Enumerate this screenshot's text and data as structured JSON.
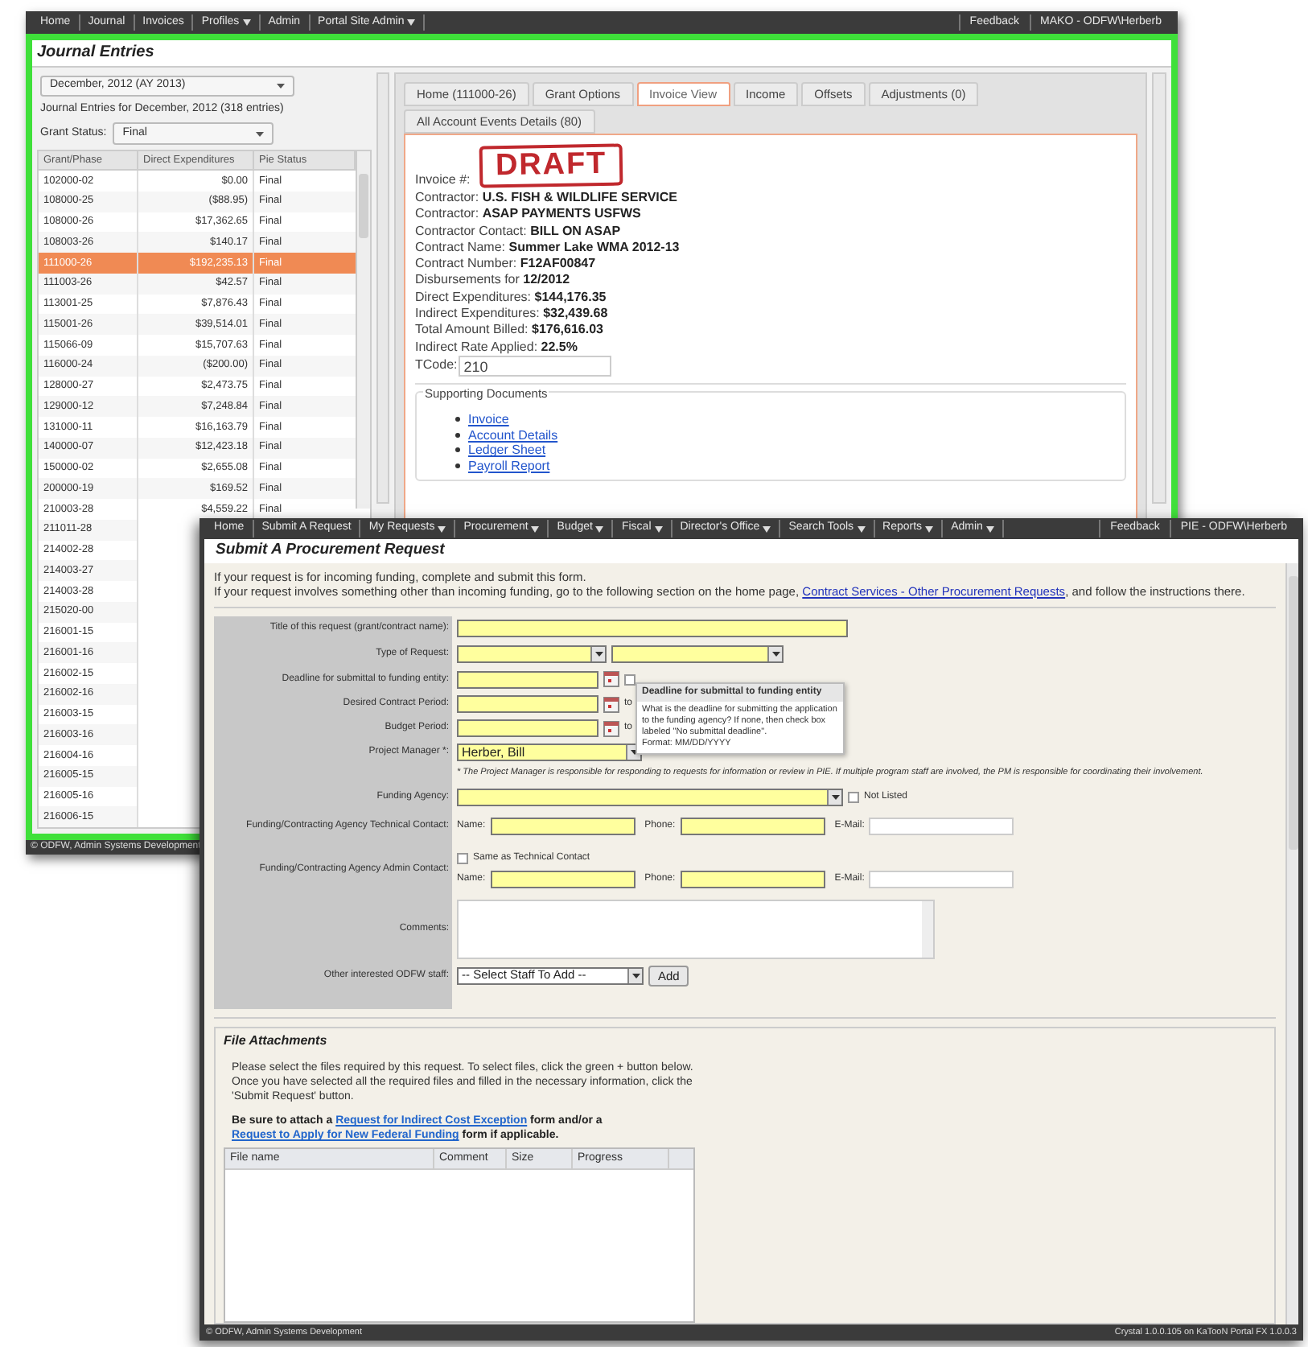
{
  "journal_window": {
    "nav": {
      "items": [
        {
          "label": "Home",
          "menu": false
        },
        {
          "label": "Journal",
          "menu": false
        },
        {
          "label": "Invoices",
          "menu": false
        },
        {
          "label": "Profiles",
          "menu": true
        },
        {
          "label": "Admin",
          "menu": false
        },
        {
          "label": "Portal Site Admin",
          "menu": true
        }
      ],
      "feedback": "Feedback",
      "user": "MAKO - ODFW\\Herberb"
    },
    "title": "Journal Entries",
    "period_select": "December, 2012 (AY 2013)",
    "summary": "Journal Entries for December, 2012 (318 entries)",
    "grant_status": {
      "label": "Grant Status:",
      "value": "Final"
    },
    "table": {
      "columns": [
        "Grant/Phase",
        "Direct Expenditures",
        "Pie Status"
      ],
      "rows": [
        {
          "grant_phase": "102000-02",
          "direct_expenditures": "$0.00",
          "pie_status": "Final",
          "selected": false
        },
        {
          "grant_phase": "108000-25",
          "direct_expenditures": "($88.95)",
          "pie_status": "Final",
          "selected": false
        },
        {
          "grant_phase": "108000-26",
          "direct_expenditures": "$17,362.65",
          "pie_status": "Final",
          "selected": false
        },
        {
          "grant_phase": "108003-26",
          "direct_expenditures": "$140.17",
          "pie_status": "Final",
          "selected": false
        },
        {
          "grant_phase": "111000-26",
          "direct_expenditures": "$192,235.13",
          "pie_status": "Final",
          "selected": true
        },
        {
          "grant_phase": "111003-26",
          "direct_expenditures": "$42.57",
          "pie_status": "Final",
          "selected": false
        },
        {
          "grant_phase": "113001-25",
          "direct_expenditures": "$7,876.43",
          "pie_status": "Final",
          "selected": false
        },
        {
          "grant_phase": "115001-26",
          "direct_expenditures": "$39,514.01",
          "pie_status": "Final",
          "selected": false
        },
        {
          "grant_phase": "115066-09",
          "direct_expenditures": "$15,707.63",
          "pie_status": "Final",
          "selected": false
        },
        {
          "grant_phase": "116000-24",
          "direct_expenditures": "($200.00)",
          "pie_status": "Final",
          "selected": false
        },
        {
          "grant_phase": "128000-27",
          "direct_expenditures": "$2,473.75",
          "pie_status": "Final",
          "selected": false
        },
        {
          "grant_phase": "129000-12",
          "direct_expenditures": "$7,248.84",
          "pie_status": "Final",
          "selected": false
        },
        {
          "grant_phase": "131000-11",
          "direct_expenditures": "$16,163.79",
          "pie_status": "Final",
          "selected": false
        },
        {
          "grant_phase": "140000-07",
          "direct_expenditures": "$12,423.18",
          "pie_status": "Final",
          "selected": false
        },
        {
          "grant_phase": "150000-02",
          "direct_expenditures": "$2,655.08",
          "pie_status": "Final",
          "selected": false
        },
        {
          "grant_phase": "200000-19",
          "direct_expenditures": "$169.52",
          "pie_status": "Final",
          "selected": false
        },
        {
          "grant_phase": "210003-28",
          "direct_expenditures": "$4,559.22",
          "pie_status": "Final",
          "selected": false
        },
        {
          "grant_phase": "211011-28",
          "selected": false
        },
        {
          "grant_phase": "214002-28",
          "selected": false
        },
        {
          "grant_phase": "214003-27",
          "selected": false
        },
        {
          "grant_phase": "214003-28",
          "selected": false
        },
        {
          "grant_phase": "215020-00",
          "selected": false
        },
        {
          "grant_phase": "216001-15",
          "selected": false
        },
        {
          "grant_phase": "216001-16",
          "selected": false
        },
        {
          "grant_phase": "216002-15",
          "selected": false
        },
        {
          "grant_phase": "216002-16",
          "selected": false
        },
        {
          "grant_phase": "216003-15",
          "selected": false
        },
        {
          "grant_phase": "216003-16",
          "selected": false
        },
        {
          "grant_phase": "216004-16",
          "selected": false
        },
        {
          "grant_phase": "216005-15",
          "selected": false
        },
        {
          "grant_phase": "216005-16",
          "selected": false
        },
        {
          "grant_phase": "216006-15",
          "selected": false
        }
      ]
    },
    "tabs": [
      {
        "label": "Home (111000-26)",
        "selected": false
      },
      {
        "label": "Grant Options",
        "selected": false
      },
      {
        "label": "Invoice View",
        "selected": true
      },
      {
        "label": "Income",
        "selected": false
      },
      {
        "label": "Offsets",
        "selected": false
      },
      {
        "label": "Adjustments (0)",
        "selected": false
      },
      {
        "label": "All Account Events Details (80)",
        "selected": false
      }
    ],
    "invoice": {
      "stamp": "DRAFT",
      "number_label": "Invoice #:",
      "fields": [
        {
          "label": "Contractor:",
          "value": "U.S. FISH & WILDLIFE SERVICE"
        },
        {
          "label": "Contractor:",
          "value": "ASAP PAYMENTS USFWS"
        },
        {
          "label": "Contractor Contact:",
          "value": "BILL ON ASAP"
        },
        {
          "label": "Contract Name:",
          "value": "Summer Lake WMA 2012-13"
        },
        {
          "label": "Contract Number:",
          "value": "F12AF00847"
        },
        {
          "label": "Disbursements for",
          "value": "12/2012"
        },
        {
          "label": "Direct Expenditures:",
          "value": "$144,176.35"
        },
        {
          "label": "Indirect Expenditures:",
          "value": "$32,439.68"
        },
        {
          "label": "Total Amount Billed:",
          "value": "$176,616.03"
        },
        {
          "label": "Indirect Rate Applied:",
          "value": "22.5%"
        }
      ],
      "tcode": {
        "label": "TCode:",
        "value": "210"
      }
    },
    "supporting_documents": {
      "title": "Supporting Documents",
      "links": [
        "Invoice",
        "Account Details",
        "Ledger Sheet",
        "Payroll Report"
      ]
    },
    "footer": "© ODFW, Admin Systems Development"
  },
  "request_window": {
    "nav": {
      "items": [
        {
          "label": "Home",
          "menu": false
        },
        {
          "label": "Submit A Request",
          "menu": false
        },
        {
          "label": "My Requests",
          "menu": true
        },
        {
          "label": "Procurement",
          "menu": true
        },
        {
          "label": "Budget",
          "menu": true
        },
        {
          "label": "Fiscal",
          "menu": true
        },
        {
          "label": "Director's Office",
          "menu": true
        },
        {
          "label": "Search Tools",
          "menu": true
        },
        {
          "label": "Reports",
          "menu": true
        },
        {
          "label": "Admin",
          "menu": true
        }
      ],
      "feedback": "Feedback",
      "user": "PIE - ODFW\\Herberb"
    },
    "title": "Submit A Procurement Request",
    "intro": {
      "line1": "If your request is for incoming funding, complete and submit this form.",
      "before": "If your request involves something other than incoming funding, go to the following section on the home page, ",
      "link": "Contract Services - Other Procurement Requests",
      "after": ", and follow the instructions there."
    },
    "form": [
      {
        "kind": "text",
        "label": "Title of this request (grant/contract name):"
      },
      {
        "kind": "double_select",
        "label": "Type of Request:"
      },
      {
        "kind": "date",
        "label": "Deadline for submittal to funding entity:",
        "checked": false
      },
      {
        "kind": "period",
        "label": "Desired Contract Period:",
        "to": "to"
      },
      {
        "kind": "period",
        "label": "Budget Period:",
        "to": "to"
      },
      {
        "kind": "select",
        "label": "Project Manager *:",
        "value": "Herber, Bill"
      },
      {
        "kind": "note",
        "text": "* The Project Manager is responsible for responding to requests for information or review in PIE. If multiple program staff are involved, the PM is responsible for coordinating their involvement."
      },
      {
        "kind": "select_check",
        "label": "Funding Agency:",
        "check_label": "Not Listed",
        "checked": false
      },
      {
        "kind": "contact",
        "label": "Funding/Contracting Agency Technical Contact:",
        "name": "Name:",
        "phone": "Phone:",
        "email": "E-Mail:"
      },
      {
        "kind": "admin_contact",
        "label": "Funding/Contracting Agency Admin Contact:",
        "check_label": "Same as Technical Contact",
        "checked": false,
        "name": "Name:",
        "phone": "Phone:",
        "email": "E-Mail:"
      },
      {
        "kind": "textarea",
        "label": "Comments:"
      },
      {
        "kind": "staff",
        "label": "Other interested ODFW staff:",
        "value": "-- Select Staff To Add --",
        "button": "Add"
      }
    ],
    "tooltip": {
      "title": "Deadline for submittal to funding entity",
      "text": "What is the deadline for submitting the application to the funding agency? If none, then check box labeled \"No submittal deadline\".",
      "format": "Format: MM/DD/YYYY"
    },
    "attachments": {
      "title": "File Attachments",
      "instructions": "Please select the files required by this request. To select files, click the green + button below. Once you have selected all the required files and filled in the necessary information, click the 'Submit Request' button.",
      "before": "Be sure to attach a ",
      "link1": "Request for Indirect Cost Exception",
      "middle": " form and/or a ",
      "link2": "Request to Apply for New Federal Funding",
      "after": " form if applicable.",
      "columns": [
        "File name",
        "Comment",
        "Size",
        "Progress"
      ]
    },
    "footer_left": "© ODFW, Admin Systems Development",
    "footer_right": "Crystal 1.0.0.105 on KaTooN Portal FX 1.0.0.3"
  }
}
